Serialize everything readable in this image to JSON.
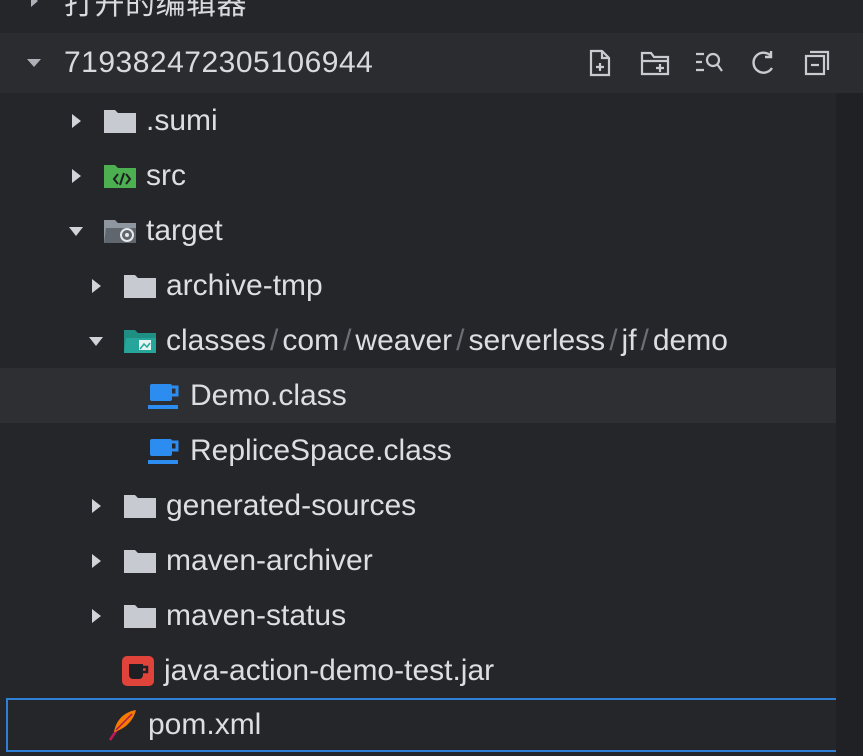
{
  "explorer": {
    "open_editors_label": "打开的编辑器",
    "project_name": "719382472305106944",
    "actions": [
      "new-file-icon",
      "new-folder-icon",
      "search-tree-icon",
      "refresh-icon",
      "collapse-all-icon"
    ]
  },
  "tree": {
    "sumi": ".sumi",
    "src": "src",
    "target": "target",
    "archive_tmp": "archive-tmp",
    "classes_path": [
      "classes",
      "com",
      "weaver",
      "serverless",
      "jf",
      "demo"
    ],
    "demo_class": "Demo.class",
    "replice_class": "RepliceSpace.class",
    "generated_sources": "generated-sources",
    "maven_archiver": "maven-archiver",
    "maven_status": "maven-status",
    "jar": "java-action-demo-test.jar",
    "pom": "pom.xml"
  },
  "colors": {
    "folder": "#c7cbd1",
    "src_folder": "#4caf50",
    "target_folder": "#9aa3ad",
    "classes_folder": "#26a69a",
    "java_class": "#2d8cf0",
    "jar": "#e0433a",
    "selected_row": "#2e2f33",
    "focus_border": "#2f7fd6"
  }
}
